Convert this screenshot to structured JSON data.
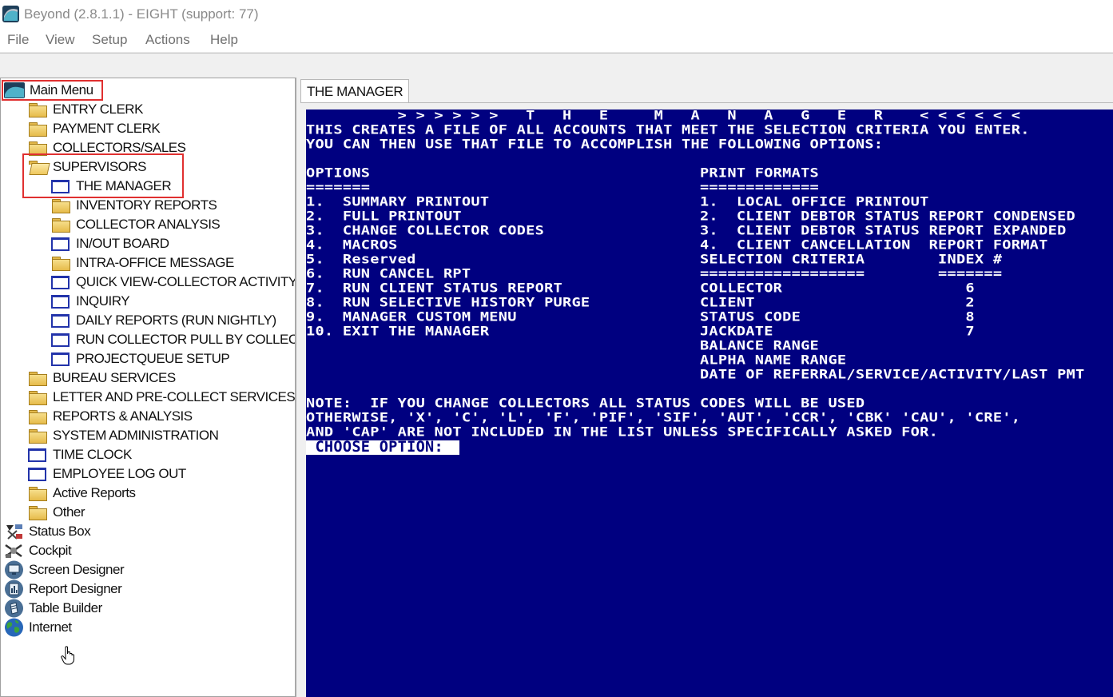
{
  "window": {
    "title": "Beyond (2.8.1.1) - EIGHT (support: 77)"
  },
  "menu": [
    "File",
    "View",
    "Setup",
    "Actions",
    "Help"
  ],
  "tree": {
    "root": "Main Menu",
    "items": [
      {
        "label": "ENTRY CLERK",
        "icon": "folder-icon"
      },
      {
        "label": "PAYMENT CLERK",
        "icon": "folder-icon"
      },
      {
        "label": "COLLECTORS/SALES",
        "icon": "folder-icon"
      },
      {
        "label": "SUPERVISORS",
        "icon": "folder-open-icon"
      },
      {
        "label": "THE MANAGER",
        "icon": "window-icon"
      },
      {
        "label": "INVENTORY REPORTS",
        "icon": "folder-icon"
      },
      {
        "label": "COLLECTOR ANALYSIS",
        "icon": "folder-icon"
      },
      {
        "label": "IN/OUT BOARD",
        "icon": "window-icon"
      },
      {
        "label": "INTRA-OFFICE MESSAGE",
        "icon": "folder-icon"
      },
      {
        "label": "QUICK VIEW-COLLECTOR ACTIVITY",
        "icon": "window-icon"
      },
      {
        "label": "INQUIRY",
        "icon": "window-icon"
      },
      {
        "label": "DAILY REPORTS (RUN NIGHTLY)",
        "icon": "window-icon"
      },
      {
        "label": "RUN COLLECTOR PULL BY COLLEC",
        "icon": "window-icon"
      },
      {
        "label": "PROJECTQUEUE SETUP",
        "icon": "window-icon"
      },
      {
        "label": "BUREAU SERVICES",
        "icon": "folder-icon"
      },
      {
        "label": "LETTER AND PRE-COLLECT SERVICES",
        "icon": "folder-icon"
      },
      {
        "label": "REPORTS & ANALYSIS",
        "icon": "folder-icon"
      },
      {
        "label": "SYSTEM ADMINISTRATION",
        "icon": "folder-icon"
      },
      {
        "label": "TIME CLOCK",
        "icon": "window-icon"
      },
      {
        "label": "EMPLOYEE LOG OUT",
        "icon": "window-icon"
      },
      {
        "label": "Active Reports",
        "icon": "folder-icon"
      },
      {
        "label": "Other",
        "icon": "folder-icon"
      },
      {
        "label": "Status Box",
        "icon": "status-box-icon"
      },
      {
        "label": "Cockpit",
        "icon": "cockpit-icon"
      },
      {
        "label": "Screen Designer",
        "icon": "screen-designer-icon"
      },
      {
        "label": "Report Designer",
        "icon": "report-designer-icon"
      },
      {
        "label": "Table Builder",
        "icon": "table-builder-icon"
      },
      {
        "label": "Internet",
        "icon": "globe-icon"
      }
    ]
  },
  "tab": {
    "label": "THE MANAGER"
  },
  "terminal": {
    "lines": [
      "          > > > > > >   T   H   E     M   A   N   A   G   E   R    < < < < < <",
      "THIS CREATES A FILE OF ALL ACCOUNTS THAT MEET THE SELECTION CRITERIA YOU ENTER.",
      "YOU CAN THEN USE THAT FILE TO ACCOMPLISH THE FOLLOWING OPTIONS:",
      "",
      "OPTIONS                                    PRINT FORMATS",
      "=======                                    =============",
      "1.  SUMMARY PRINTOUT                       1.  LOCAL OFFICE PRINTOUT",
      "2.  FULL PRINTOUT                          2.  CLIENT DEBTOR STATUS REPORT CONDENSED",
      "3.  CHANGE COLLECTOR CODES                 3.  CLIENT DEBTOR STATUS REPORT EXPANDED",
      "4.  MACROS                                 4.  CLIENT CANCELLATION  REPORT FORMAT",
      "5.  Reserved                               SELECTION CRITERIA        INDEX #",
      "6.  RUN CANCEL RPT                         ==================        =======",
      "7.  RUN CLIENT STATUS REPORT               COLLECTOR                    6",
      "8.  RUN SELECTIVE HISTORY PURGE            CLIENT                       2",
      "9.  MANAGER CUSTOM MENU                    STATUS CODE                  8",
      "10. EXIT THE MANAGER                       JACKDATE                     7",
      "                                           BALANCE RANGE",
      "                                           ALPHA NAME RANGE",
      "                                           DATE OF REFERRAL/SERVICE/ACTIVITY/LAST PMT",
      "",
      "NOTE:  IF YOU CHANGE COLLECTORS ALL STATUS CODES WILL BE USED",
      "OTHERWISE, 'X', 'C', 'L', 'F', 'PIF', 'SIF', 'AUT', 'CCR', 'CBK' 'CAU', 'CRE',",
      "AND 'CAP' ARE NOT INCLUDED IN THE LIST UNLESS SPECIFICALLY ASKED FOR."
    ],
    "prompt": " CHOOSE OPTION: "
  },
  "colors": {
    "terminal_bg": "#000080",
    "terminal_fg": "#ffffff",
    "highlight": "#e03030"
  }
}
